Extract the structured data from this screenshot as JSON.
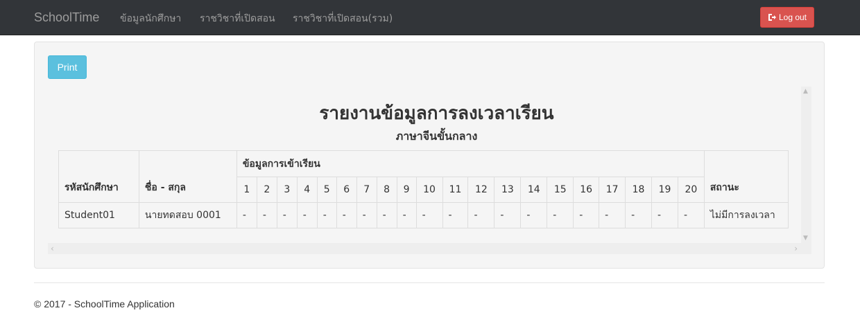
{
  "nav": {
    "brand": "SchoolTime",
    "items": [
      {
        "label": "ข้อมูลนักศึกษา"
      },
      {
        "label": "ราชวิชาที่เปิดสอน"
      },
      {
        "label": "ราชวิชาที่เปิดสอน(รวม)"
      }
    ],
    "logout_label": "Log out",
    "logout_icon": "sign-out-icon",
    "colors": {
      "navbar": "#323539",
      "logout": "#d9534f"
    }
  },
  "toolbar": {
    "print_label": "Print",
    "print_color": "#5bc0de"
  },
  "report": {
    "title": "รายงานข้อมูลการลงเวลาเรียน",
    "subtitle": "ภาษาจีนขั้นกลาง",
    "headers": {
      "student_id": "รหัสนักศึกษา",
      "name": "ชื่อ - สกุล",
      "attendance": "ข้อมูลการเข้าเรียน",
      "status": "สถานะ"
    },
    "sessions": [
      "1",
      "2",
      "3",
      "4",
      "5",
      "6",
      "7",
      "8",
      "9",
      "10",
      "11",
      "12",
      "13",
      "14",
      "15",
      "16",
      "17",
      "18",
      "19",
      "20"
    ],
    "rows": [
      {
        "student_id": "Student01",
        "name": "นายทดสอบ 0001",
        "sessions": [
          "-",
          "-",
          "-",
          "-",
          "-",
          "-",
          "-",
          "-",
          "-",
          "-",
          "-",
          "-",
          "-",
          "-",
          "-",
          "-",
          "-",
          "-",
          "-",
          "-"
        ],
        "status": "ไม่มีการลงเวลา"
      }
    ]
  },
  "footer": {
    "text": "© 2017 - SchoolTime Application"
  }
}
